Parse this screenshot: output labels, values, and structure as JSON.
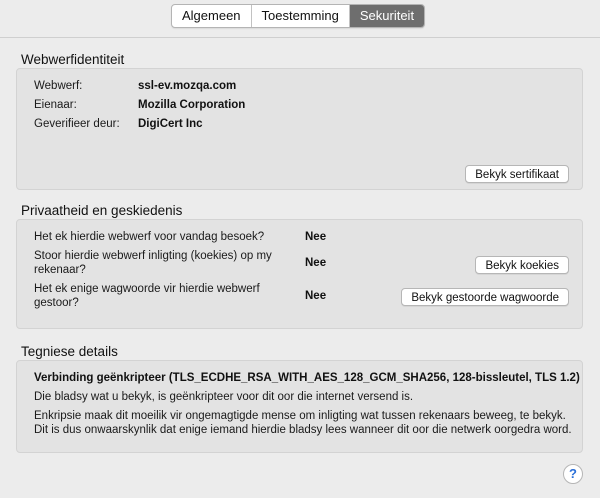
{
  "tabs": [
    {
      "label": "Algemeen",
      "active": false
    },
    {
      "label": "Toestemming",
      "active": false
    },
    {
      "label": "Sekuriteit",
      "active": true
    }
  ],
  "identity": {
    "title": "Webwerfidentiteit",
    "website_label": "Webwerf:",
    "website_value": "ssl-ev.mozqa.com",
    "owner_label": "Eienaar:",
    "owner_value": "Mozilla Corporation",
    "verifier_label": "Geverifieer deur:",
    "verifier_value": "DigiCert Inc",
    "view_cert_button": "Bekyk sertifikaat"
  },
  "privacy": {
    "title": "Privaatheid en geskiedenis",
    "q1": "Het ek hierdie webwerf voor vandag besoek?",
    "a1": "Nee",
    "q2_line1": "Stoor hierdie webwerf inligting (koekies) op my",
    "q2_line2": "rekenaar?",
    "a2": "Nee",
    "q3_line1": "Het ek enige wagwoorde vir hierdie webwerf",
    "q3_line2": "gestoor?",
    "a3": "Nee",
    "view_cookies_button": "Bekyk koekies",
    "view_passwords_button": "Bekyk gestoorde wagwoorde"
  },
  "technical": {
    "title": "Tegniese details",
    "connection": "Verbinding geënkripteer (TLS_ECDHE_RSA_WITH_AES_128_GCM_SHA256, 128-bissleutel, TLS 1.2)",
    "line1": "Die bladsy wat u bekyk, is geënkripteer voor dit oor die internet versend is.",
    "line2": "Enkripsie maak dit moeilik vir ongemagtigde mense om inligting wat tussen rekenaars beweeg, te bekyk.",
    "line3": "Dit is dus onwaarskynlik dat enige iemand hierdie bladsy lees wanneer dit oor die netwerk oorgedra word."
  },
  "help_icon": "?"
}
